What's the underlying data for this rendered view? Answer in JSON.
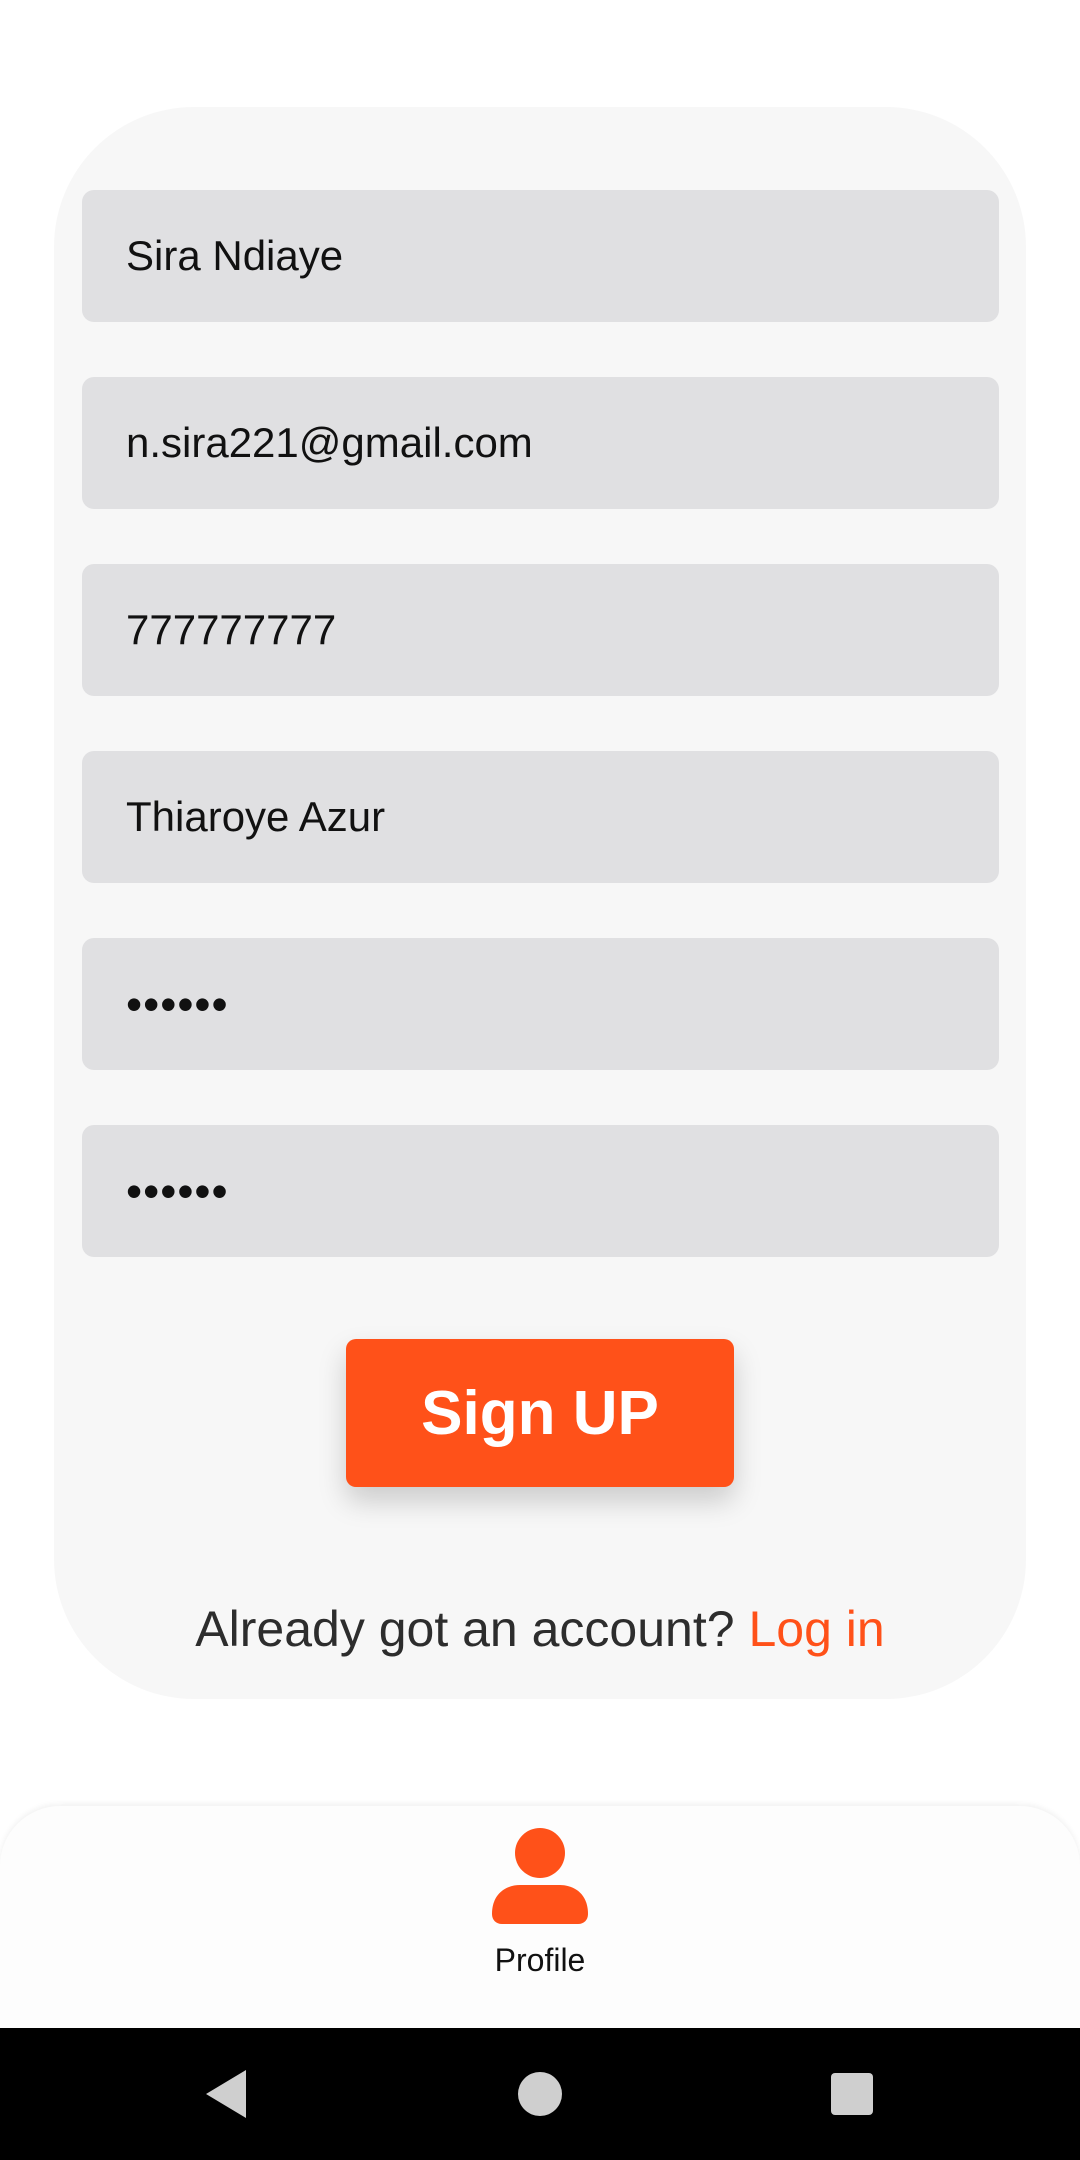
{
  "form": {
    "name_value": "Sira Ndiaye",
    "email_value": "n.sira221@gmail.com",
    "phone_value": "777777777",
    "address_value": "Thiaroye Azur",
    "password_value": "••••••",
    "confirm_password_value": "••••••",
    "signup_label": "Sign UP",
    "login_prompt": "Already got an account? ",
    "login_link": "Log in"
  },
  "bottom_nav": {
    "items": [
      {
        "label": "Profile",
        "icon": "person-icon"
      }
    ]
  },
  "colors": {
    "accent": "#ff5119",
    "field_bg": "#e0e0e2",
    "card_bg": "#f7f7f7"
  },
  "system_nav": {
    "icons": [
      "back-icon",
      "home-icon",
      "recents-icon"
    ]
  }
}
